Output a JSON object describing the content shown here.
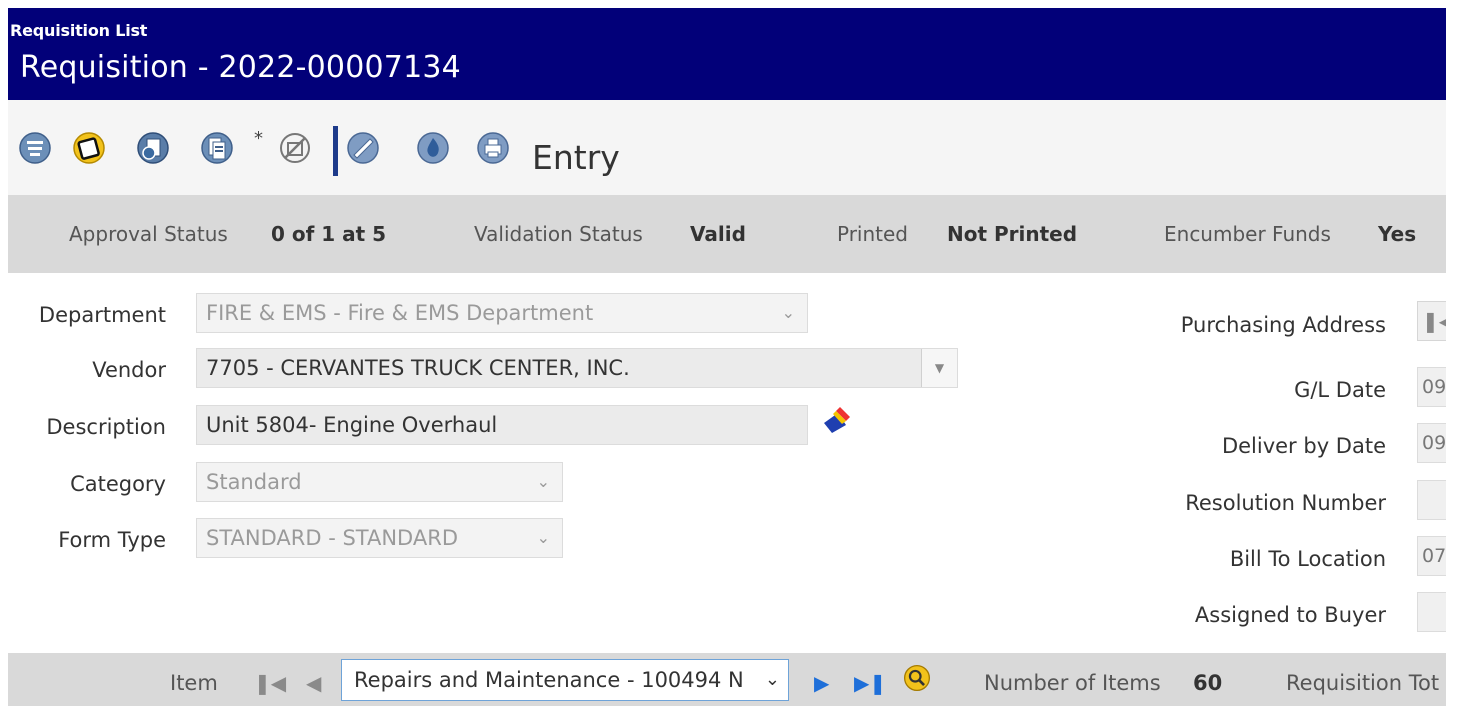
{
  "header": {
    "breadcrumb": "Requisition List",
    "title": "Requisition - 2022-00007134"
  },
  "toolbar": {
    "star": "*",
    "mode_label": "Entry",
    "icons": [
      "list-icon",
      "notepad-icon",
      "globe-document-icon",
      "copy-document-icon",
      "cancel-icon",
      "approve-icon",
      "flame-icon",
      "print-icon"
    ]
  },
  "status": {
    "approval_label": "Approval Status",
    "approval_value": "0 of 1 at 5",
    "validation_label": "Validation Status",
    "validation_value": "Valid",
    "printed_label": "Printed",
    "printed_value": "Not Printed",
    "encumber_label": "Encumber Funds",
    "encumber_value": "Yes"
  },
  "form": {
    "department_label": "Department",
    "department_value": "FIRE & EMS - Fire & EMS Department",
    "vendor_label": "Vendor",
    "vendor_value": "7705 - CERVANTES TRUCK CENTER, INC.",
    "description_label": "Description",
    "description_value": "Unit 5804- Engine Overhaul",
    "category_label": "Category",
    "category_value": "Standard",
    "form_type_label": "Form Type",
    "form_type_value": "STANDARD - STANDARD"
  },
  "right": {
    "purchasing_address_label": "Purchasing Address",
    "gl_date_label": "G/L Date",
    "gl_date_value": "09",
    "deliver_by_label": "Deliver by Date",
    "deliver_by_value": "09",
    "resolution_label": "Resolution Number",
    "resolution_value": "",
    "bill_to_label": "Bill To Location",
    "bill_to_value": "07",
    "assigned_buyer_label": "Assigned to Buyer",
    "assigned_buyer_value": ""
  },
  "items": {
    "item_label": "Item",
    "selected_item": "Repairs and Maintenance - 100494 N",
    "count_label": "Number of Items",
    "count_value": "60",
    "total_label": "Requisition Tot"
  },
  "colors": {
    "header_bg": "#020079",
    "status_bg": "#d9d9d9",
    "nav_blue": "#1e6fd9"
  }
}
